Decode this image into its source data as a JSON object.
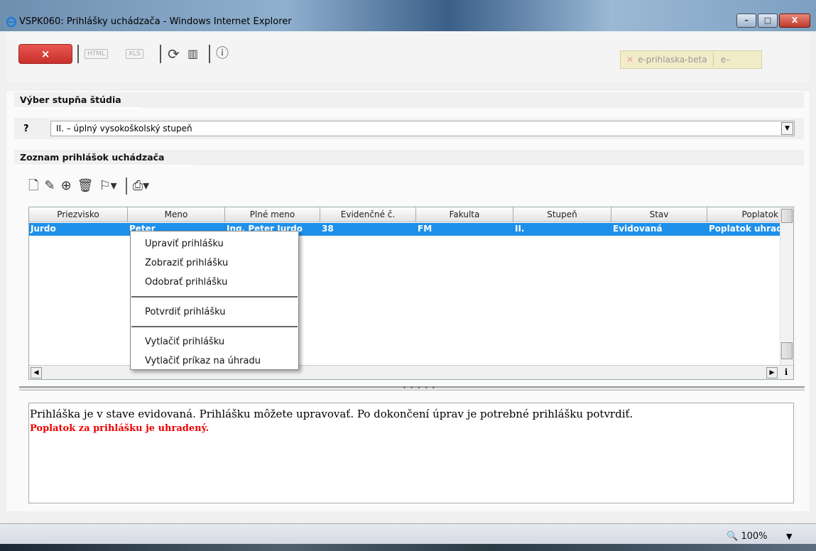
{
  "window": {
    "title": "VSPK060: Prihlášky uchádzača - Windows Internet Explorer",
    "controls": {
      "minimize": "–",
      "maximize": "□",
      "close": "X"
    }
  },
  "toolbar": {
    "close_label": "×",
    "html_label": "HTML",
    "xls_label": "XLS",
    "icons": [
      "refresh-icon",
      "chart-icon",
      "info-icon"
    ],
    "eprihlaska_label": "e-prihlaska-beta",
    "eminus_label": "e–"
  },
  "study_level": {
    "header": "Výber stupňa štúdia",
    "help": "?",
    "selected": "II. – úplný vysokoškolský stupeň"
  },
  "applications": {
    "header": "Zoznam prihlášok uchádzača",
    "columns": [
      "Priezvisko",
      "Meno",
      "Plné meno",
      "Evidenčné č.",
      "Fakulta",
      "Stupeň",
      "Stav",
      "Poplatok"
    ],
    "rows": [
      {
        "priezvisko": "Jurdo",
        "meno": "Peter",
        "plne_meno": "Ing. Peter Jurdo",
        "evid": "38",
        "fakulta": "FM",
        "stupen": "II.",
        "stav": "Evidovaná",
        "poplatok": "Poplatok uhradený"
      }
    ]
  },
  "context_menu": {
    "edit": "Upraviť prihlášku",
    "view": "Zobraziť prihlášku",
    "remove": "Odobrať prihlášku",
    "confirm": "Potvrdiť prihlášku",
    "print": "Vytlačiť prihlášku",
    "print_payment": "Vytlačiť príkaz na úhradu"
  },
  "message": {
    "info": "Prihláška je v stave evidovaná. Prihlášku môžete upravovať. Po dokončení úprav je potrebné prihlášku potvrdiť.",
    "fee": "Poplatok za prihlášku je uhradený."
  },
  "statusbar": {
    "zoom": "100%"
  },
  "colors": {
    "selection": "#1e90ea",
    "close_button": "#d9403a",
    "fee_text": "#e00000"
  }
}
